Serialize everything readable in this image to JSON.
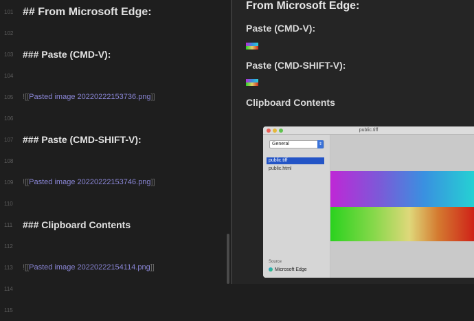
{
  "editor": {
    "lines": [
      {
        "num": "101",
        "type": "h2",
        "text": "## From Microsoft Edge:"
      },
      {
        "num": "102",
        "type": "blank",
        "text": ""
      },
      {
        "num": "103",
        "type": "h3",
        "text": "### Paste (CMD-V):"
      },
      {
        "num": "104",
        "type": "blank",
        "text": ""
      },
      {
        "num": "105",
        "type": "link",
        "prefix": "![[",
        "text": "Pasted image 20220222153736.png",
        "suffix": "]]"
      },
      {
        "num": "106",
        "type": "blank",
        "text": ""
      },
      {
        "num": "107",
        "type": "h3",
        "text": "### Paste (CMD-SHIFT-V):"
      },
      {
        "num": "108",
        "type": "blank",
        "text": ""
      },
      {
        "num": "109",
        "type": "link",
        "prefix": "![[",
        "text": "Pasted image 20220222153746.png",
        "suffix": "]]"
      },
      {
        "num": "110",
        "type": "blank",
        "text": ""
      },
      {
        "num": "111",
        "type": "h3",
        "text": "### Clipboard Contents"
      },
      {
        "num": "112",
        "type": "blank",
        "text": ""
      },
      {
        "num": "113",
        "type": "link",
        "prefix": "![[",
        "text": "Pasted image 20220222154114.png",
        "suffix": "]]"
      },
      {
        "num": "114",
        "type": "blank",
        "text": ""
      },
      {
        "num": "115",
        "type": "blank",
        "text": ""
      }
    ]
  },
  "preview": {
    "heading": "From Microsoft Edge:",
    "section1": "Paste (CMD-V):",
    "section2": "Paste (CMD-SHIFT-V):",
    "section3": "Clipboard Contents"
  },
  "clipboard_window": {
    "title": "public.tiff",
    "dropdown_value": "General",
    "types": [
      "public.tiff",
      "public.html"
    ],
    "selected_index": 0,
    "source_label": "Source",
    "source_value": "Microsoft Edge"
  },
  "colors": {
    "editor_bg": "#1e1e1e",
    "preview_bg": "#252525",
    "link": "#8a86d6",
    "selection": "#2354c6",
    "traffic_red": "#ec5f56",
    "traffic_yellow": "#e5b83a",
    "traffic_green": "#5fc24e"
  },
  "icons": {
    "dropdown": "chevron-updown-icon",
    "source_app": "edge-icon"
  }
}
